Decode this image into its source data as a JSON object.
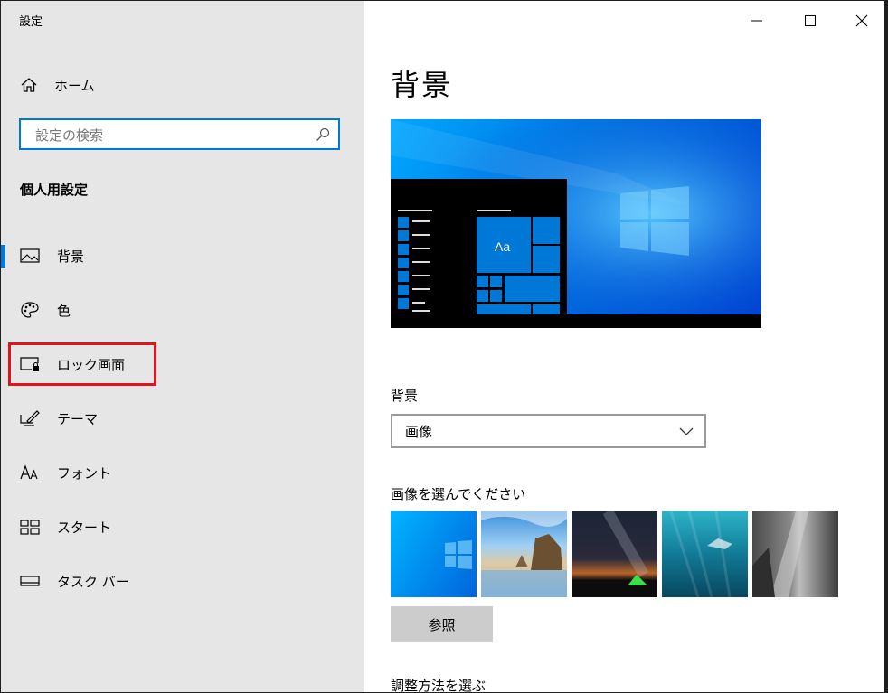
{
  "window": {
    "title": "設定"
  },
  "sidebar": {
    "home_label": "ホーム",
    "search_placeholder": "設定の検索",
    "section_title": "個人用設定",
    "items": [
      {
        "label": "背景",
        "icon": "picture-icon",
        "active": true
      },
      {
        "label": "色",
        "icon": "palette-icon",
        "active": false
      },
      {
        "label": "ロック画面",
        "icon": "lock-screen-icon",
        "active": false
      },
      {
        "label": "テーマ",
        "icon": "theme-pen-icon",
        "active": false
      },
      {
        "label": "フォント",
        "icon": "font-icon",
        "active": false
      },
      {
        "label": "スタート",
        "icon": "start-tiles-icon",
        "active": false
      },
      {
        "label": "タスク バー",
        "icon": "taskbar-icon",
        "active": false
      }
    ]
  },
  "main": {
    "title": "背景",
    "preview": {
      "tile_text": "Aa"
    },
    "background_label": "背景",
    "background_value": "画像",
    "choose_label": "画像を選んでください",
    "thumbnails": [
      "windows-default",
      "beach-rocks",
      "night-sky-tent",
      "underwater-swimmer",
      "rock-climber"
    ],
    "browse_label": "参照",
    "fit_label": "調整方法を選ぶ"
  },
  "colors": {
    "accent": "#0078d7",
    "sidebar_bg": "#e6e6e6",
    "highlight": "#e1141e"
  }
}
